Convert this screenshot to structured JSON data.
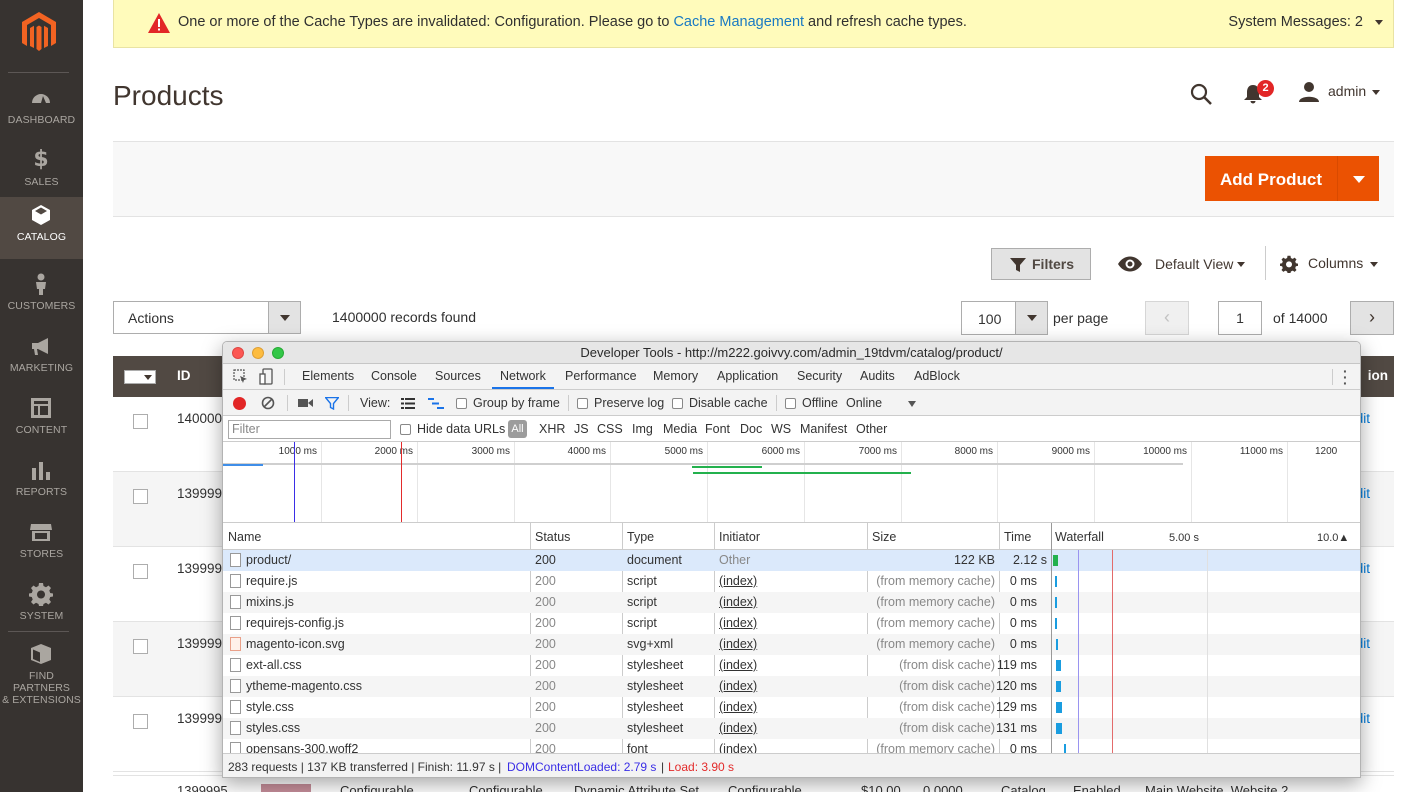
{
  "sidebar": {
    "items": [
      {
        "label": "DASHBOARD",
        "icon": "dashboard-icon"
      },
      {
        "label": "SALES",
        "icon": "dollar-icon"
      },
      {
        "label": "CATALOG",
        "icon": "cube-icon",
        "active": true
      },
      {
        "label": "CUSTOMERS",
        "icon": "person-icon"
      },
      {
        "label": "MARKETING",
        "icon": "megaphone-icon"
      },
      {
        "label": "CONTENT",
        "icon": "layout-icon"
      },
      {
        "label": "REPORTS",
        "icon": "bar-chart-icon"
      },
      {
        "label": "STORES",
        "icon": "store-icon"
      },
      {
        "label": "SYSTEM",
        "icon": "gear-icon"
      },
      {
        "label": "FIND PARTNERS\n& EXTENSIONS",
        "label_line1": "FIND PARTNERS",
        "label_line2": "& EXTENSIONS",
        "icon": "box-icon"
      }
    ]
  },
  "message": {
    "text_before": "One or more of the Cache Types are invalidated: Configuration. Please go to ",
    "link": "Cache Management",
    "text_after": " and refresh cache types.",
    "system_messages": "System Messages: 2"
  },
  "header": {
    "title": "Products",
    "notification_count": "2",
    "user": "admin"
  },
  "actions": {
    "add_product": "Add Product",
    "filters": "Filters",
    "default_view": "Default View",
    "columns": "Columns",
    "actions_select": "Actions",
    "records_found": "1400000 records found",
    "per_page_value": "100",
    "per_page_label": "per page",
    "page_value": "1",
    "of_pages": "of 14000",
    "prev": "‹",
    "next": "›"
  },
  "grid": {
    "id_header": "ID",
    "action_header": "ion",
    "rows": [
      {
        "id": "140000",
        "edit": "dit"
      },
      {
        "id": "139999",
        "edit": "dit"
      },
      {
        "id": "139999",
        "edit": "dit"
      },
      {
        "id": "139999",
        "edit": "dit"
      },
      {
        "id": "139999",
        "edit": "dit"
      }
    ],
    "last_row": {
      "id": "1399995",
      "name": "Configurable",
      "type": "Configurable",
      "attribute_set": "Dynamic Attribute Set",
      "sku": "Configurable",
      "price": "$10.00",
      "qty": "0.0000",
      "visibility": "Catalog",
      "status": "Enabled",
      "websites": "Main Website, Website 2"
    }
  },
  "devtools": {
    "title": "Developer Tools - http://m222.goivvy.com/admin_19tdvm/catalog/product/",
    "tabs": [
      "Elements",
      "Console",
      "Sources",
      "Network",
      "Performance",
      "Memory",
      "Application",
      "Security",
      "Audits",
      "AdBlock"
    ],
    "active_tab": "Network",
    "toolbar": {
      "view": "View:",
      "group_by_frame": "Group by frame",
      "preserve_log": "Preserve log",
      "disable_cache": "Disable cache",
      "offline": "Offline",
      "online": "Online"
    },
    "filter": {
      "placeholder": "Filter",
      "hide_data_urls": "Hide data URLs",
      "types": [
        "All",
        "XHR",
        "JS",
        "CSS",
        "Img",
        "Media",
        "Font",
        "Doc",
        "WS",
        "Manifest",
        "Other"
      ]
    },
    "overview_ticks": [
      "1000 ms",
      "2000 ms",
      "3000 ms",
      "4000 ms",
      "5000 ms",
      "6000 ms",
      "7000 ms",
      "8000 ms",
      "9000 ms",
      "10000 ms",
      "11000 ms",
      "1200"
    ],
    "columns": {
      "name": "Name",
      "status": "Status",
      "type": "Type",
      "initiator": "Initiator",
      "size": "Size",
      "time": "Time",
      "waterfall": "Waterfall",
      "wf_mid": "5.00 s",
      "wf_end": "10.0▲"
    },
    "requests": [
      {
        "name": "product/",
        "status": "200",
        "type": "document",
        "initiator": "Other",
        "size": "122 KB",
        "time": "2.12 s",
        "icon": "file-icon"
      },
      {
        "name": "require.js",
        "status": "200",
        "type": "script",
        "initiator": "(index)",
        "size": "(from memory cache)",
        "time": "0 ms",
        "icon": "file-icon"
      },
      {
        "name": "mixins.js",
        "status": "200",
        "type": "script",
        "initiator": "(index)",
        "size": "(from memory cache)",
        "time": "0 ms",
        "icon": "file-icon"
      },
      {
        "name": "requirejs-config.js",
        "status": "200",
        "type": "script",
        "initiator": "(index)",
        "size": "(from memory cache)",
        "time": "0 ms",
        "icon": "file-icon"
      },
      {
        "name": "magento-icon.svg",
        "status": "200",
        "type": "svg+xml",
        "initiator": "(index)",
        "size": "(from memory cache)",
        "time": "0 ms",
        "icon": "svg-file-icon"
      },
      {
        "name": "ext-all.css",
        "status": "200",
        "type": "stylesheet",
        "initiator": "(index)",
        "size": "(from disk cache)",
        "time": "119 ms",
        "icon": "file-icon"
      },
      {
        "name": "ytheme-magento.css",
        "status": "200",
        "type": "stylesheet",
        "initiator": "(index)",
        "size": "(from disk cache)",
        "time": "120 ms",
        "icon": "file-icon"
      },
      {
        "name": "style.css",
        "status": "200",
        "type": "stylesheet",
        "initiator": "(index)",
        "size": "(from disk cache)",
        "time": "129 ms",
        "icon": "file-icon"
      },
      {
        "name": "styles.css",
        "status": "200",
        "type": "stylesheet",
        "initiator": "(index)",
        "size": "(from disk cache)",
        "time": "131 ms",
        "icon": "file-icon"
      },
      {
        "name": "opensans-300.woff2",
        "status": "200",
        "type": "font",
        "initiator": "(index)",
        "size": "(from memory cache)",
        "time": "0 ms",
        "icon": "file-icon"
      }
    ],
    "status_bar": {
      "summary": "283 requests | 137 KB transferred | Finish: 11.97 s |",
      "dom_loaded": "DOMContentLoaded: 2.79 s",
      "sep": "|",
      "load": "Load: 3.90 s"
    }
  },
  "colors": {
    "brand": "#eb5202",
    "sidebar": "#373330",
    "active_nav": "#514943",
    "link": "#1979c3",
    "dom_loaded": "#3a2ee6",
    "load": "#e32b2b"
  }
}
